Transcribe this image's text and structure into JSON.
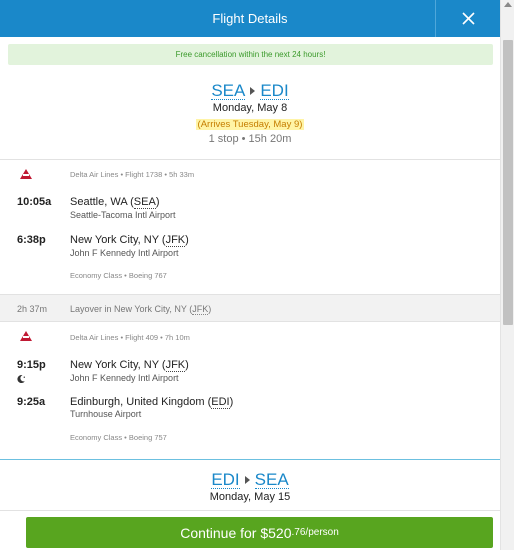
{
  "header": {
    "title": "Flight Details",
    "close_icon": "close-icon"
  },
  "notice": "Free cancellation within the next 24 hours!",
  "outbound": {
    "from": "SEA",
    "to": "EDI",
    "date": "Monday, May 8",
    "arrives": "(Arrives Tuesday, May 9)",
    "summary": "1 stop • 15h 20m",
    "segments": [
      {
        "airline_icon": "delta-airline-icon",
        "info": "Delta Air Lines • Flight 1738 • 5h 33m",
        "depart_time": "10:05a",
        "depart_city": "Seattle, WA (",
        "depart_code": "SEA",
        "depart_airport": "Seattle-Tacoma Intl Airport",
        "arrive_time": "6:38p",
        "arrive_city": "New York City, NY (",
        "arrive_code": "JFK",
        "arrive_airport": "John F Kennedy Intl Airport",
        "cabin": "Economy Class • Boeing 767"
      },
      {
        "airline_icon": "delta-airline-icon",
        "info": "Delta Air Lines • Flight 409 • 7h 10m",
        "depart_time": "9:15p",
        "depart_city": "New York City, NY (",
        "depart_code": "JFK",
        "depart_airport": "John F Kennedy Intl Airport",
        "arrive_time": "9:25a",
        "arrive_city": "Edinburgh, United Kingdom (",
        "arrive_code": "EDI",
        "arrive_airport": "Turnhouse Airport",
        "cabin": "Economy Class • Boeing 757"
      }
    ],
    "layover": {
      "duration": "2h 37m",
      "text": "Layover in New York City, NY (",
      "code": "JFK"
    }
  },
  "return": {
    "from": "EDI",
    "to": "SEA",
    "date": "Monday, May 15"
  },
  "footer": {
    "label": "Continue for $520",
    "cents": ".76/person"
  },
  "colors": {
    "header_blue": "#1a88c9",
    "continue_green": "#58a51f",
    "delta_red": "#c01933",
    "notice_green": "#3b9a2b"
  }
}
